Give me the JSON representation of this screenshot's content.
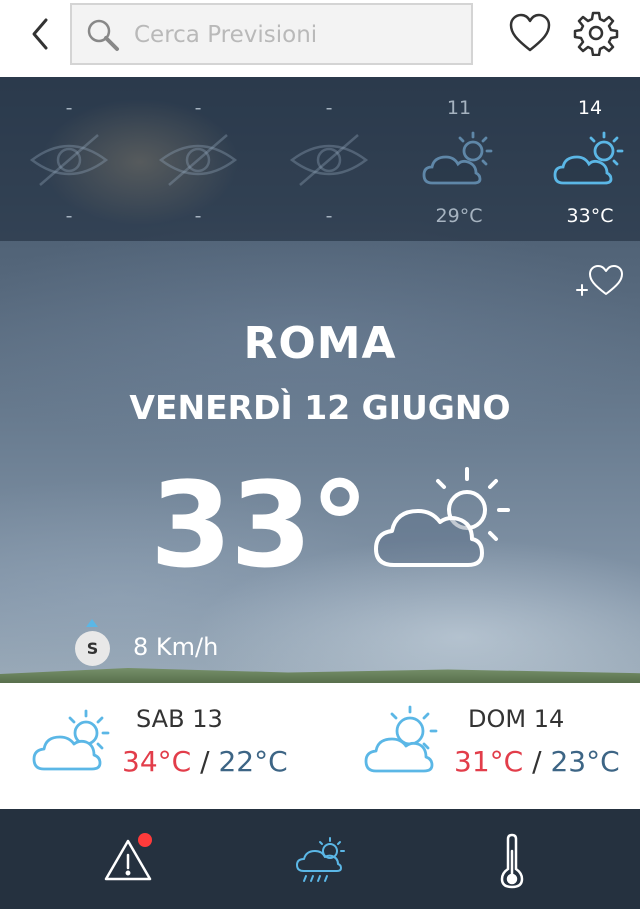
{
  "header": {
    "search_placeholder": "Cerca Previsioni",
    "icons": [
      "chevron-left-icon",
      "search-icon",
      "heart-icon",
      "gear-icon"
    ]
  },
  "hourly": [
    {
      "time": "-",
      "temp": "-",
      "icon": "eye-off-icon",
      "active": false
    },
    {
      "time": "-",
      "temp": "-",
      "icon": "eye-off-icon",
      "active": false
    },
    {
      "time": "-",
      "temp": "-",
      "icon": "eye-off-icon",
      "active": false
    },
    {
      "time": "11",
      "temp": "29°C",
      "icon": "partly-cloudy-icon",
      "active": false
    },
    {
      "time": "14",
      "temp": "33°C",
      "icon": "partly-cloudy-icon",
      "active": true
    }
  ],
  "current": {
    "city": "ROMA",
    "date": "VENERDÌ 12 GIUGNO",
    "temperature": "33°",
    "icon": "partly-cloudy-icon",
    "wind_direction": "S",
    "wind_speed": "8 Km/h"
  },
  "daily": [
    {
      "day": "SAB 13",
      "max": "34°C",
      "min": "22°C",
      "icon": "partly-cloudy-icon"
    },
    {
      "day": "DOM 14",
      "max": "31°C",
      "min": "23°C",
      "icon": "partly-cloudy-icon"
    }
  ],
  "temp_separator": "/",
  "bottom_nav": {
    "items": [
      "warning-icon",
      "weather-rain-icon",
      "thermometer-icon"
    ],
    "alert_badge": true
  },
  "colors": {
    "accent_blue": "#5bb7e6",
    "max_temp": "#e23d4a",
    "min_temp": "#3d6585",
    "nav_bg": "#25313f",
    "alert": "#ff3b3b"
  }
}
